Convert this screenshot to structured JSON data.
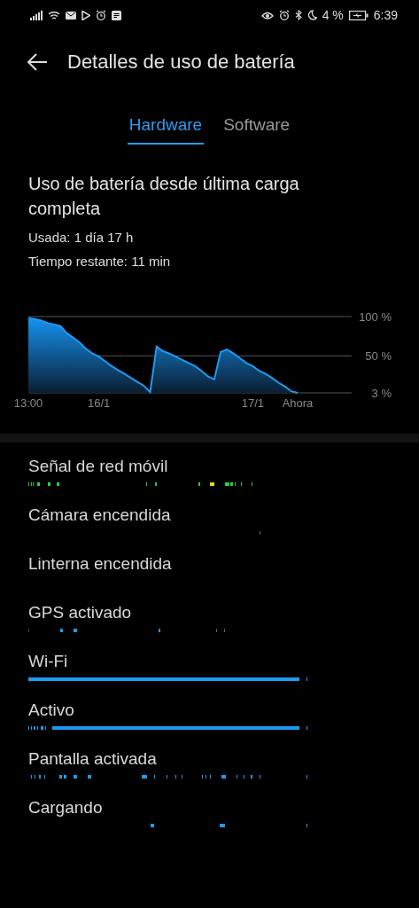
{
  "status_bar": {
    "battery": "4 %",
    "time": "6:39"
  },
  "header": {
    "title": "Detalles de uso de batería"
  },
  "tabs": [
    {
      "label": "Hardware",
      "selected": true
    },
    {
      "label": "Software",
      "selected": false
    }
  ],
  "summary": {
    "title": "Uso de batería desde última carga completa",
    "used": "Usada: 1 día 17 h",
    "remaining": "Tiempo restante: 11 min"
  },
  "chart_data": {
    "type": "area",
    "ylim": [
      0,
      100
    ],
    "categories": [
      "13:00",
      null,
      null,
      null,
      null,
      null,
      null,
      null,
      null,
      null,
      null,
      "16/1",
      null,
      null,
      null,
      null,
      null,
      null,
      null,
      null,
      null,
      null,
      null,
      null,
      null,
      null,
      null,
      null,
      null,
      null,
      null,
      null,
      null,
      null,
      null,
      "17/1",
      null,
      null,
      null,
      null,
      null,
      null,
      "Ahora"
    ],
    "yticks": [
      {
        "value": 100,
        "label": "100 %"
      },
      {
        "value": 50,
        "label": "50 %"
      },
      {
        "value": 3,
        "label": "3 %"
      }
    ],
    "series": [
      {
        "color": "#1e9bf0",
        "values": [
          98,
          97,
          95,
          92,
          90,
          88,
          79,
          73,
          67,
          59,
          53,
          49,
          43,
          37,
          32,
          27,
          22,
          17,
          12,
          4,
          62,
          56,
          53,
          49,
          45,
          41,
          37,
          31,
          24,
          20,
          55,
          58,
          53,
          47,
          41,
          37,
          31,
          27,
          22,
          16,
          11,
          5,
          3
        ]
      }
    ]
  },
  "items": [
    {
      "label": "Señal de red móvil"
    },
    {
      "label": "Cámara encendida"
    },
    {
      "label": "Linterna encendida"
    },
    {
      "label": "GPS activado"
    },
    {
      "label": "Wi-Fi"
    },
    {
      "label": "Activo"
    },
    {
      "label": "Pantalla activada"
    },
    {
      "label": "Cargando"
    }
  ]
}
